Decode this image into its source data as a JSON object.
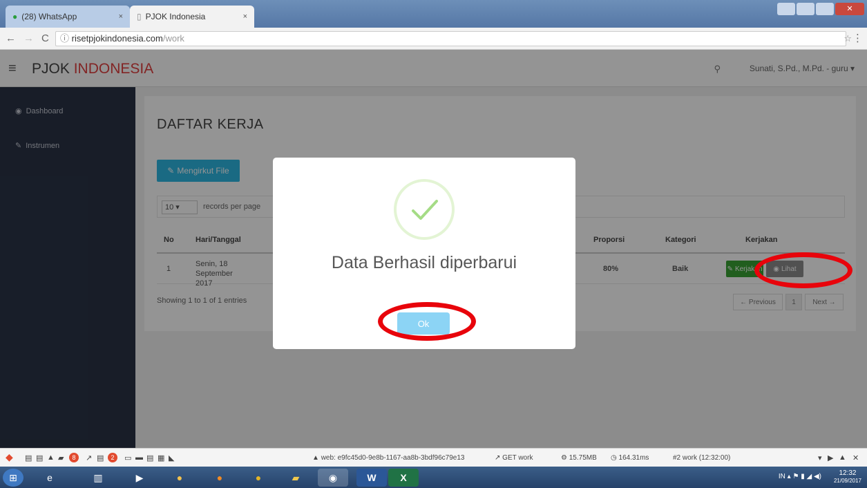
{
  "browser": {
    "tabs": [
      {
        "label": "(28) WhatsApp",
        "active": false
      },
      {
        "label": "PJOK Indonesia",
        "active": true
      }
    ],
    "tab_close": "×",
    "url_host": "risetpjokindonesia.com",
    "url_path": "/work"
  },
  "header": {
    "brand_part1": "PJOK",
    "brand_part2": "INDONESIA",
    "user": "Sunati, S.Pd., M.Pd. - guru"
  },
  "sidebar": {
    "items": [
      {
        "label": "Dashboard",
        "icon": "dashboard-icon"
      },
      {
        "label": "Instrumen",
        "icon": "edit-icon"
      }
    ]
  },
  "main": {
    "title": "DAFTAR KERJA",
    "upload_label": "Mengirkut File",
    "length_value": "10",
    "length_label": "records per page",
    "columns": [
      "No",
      "Hari/Tanggal",
      "Proporsi",
      "Kategori",
      "Kerjakan"
    ],
    "rows": [
      {
        "no": "1",
        "date": "Senin, 18 September 2017",
        "proporsi": "80%",
        "kategori": "Baik",
        "action1": "Kerjakan",
        "action2": "Lihat"
      }
    ],
    "info": "Showing 1 to 1 of 1 entries",
    "pager": {
      "prev": "← Previous",
      "page": "1",
      "next": "Next →"
    }
  },
  "modal": {
    "title": "Data Berhasil diperbarui",
    "ok_label": "Ok"
  },
  "debugbar": {
    "web": "web: e9fc45d0-9e8b-1167-aa8b-3bdf96c79e13",
    "route": "GET work",
    "memory": "15.75MB",
    "time": "164.31ms",
    "request": "#2 work (12:32:00)",
    "badge1": "8",
    "badge2": "2"
  },
  "taskbar": {
    "time": "12:32",
    "date": "21/09/2017"
  },
  "colors": {
    "accent": "#2eb7e2",
    "brand_red": "#e14040",
    "sidebar": "#2a3346",
    "annotation": "#e8040b"
  }
}
